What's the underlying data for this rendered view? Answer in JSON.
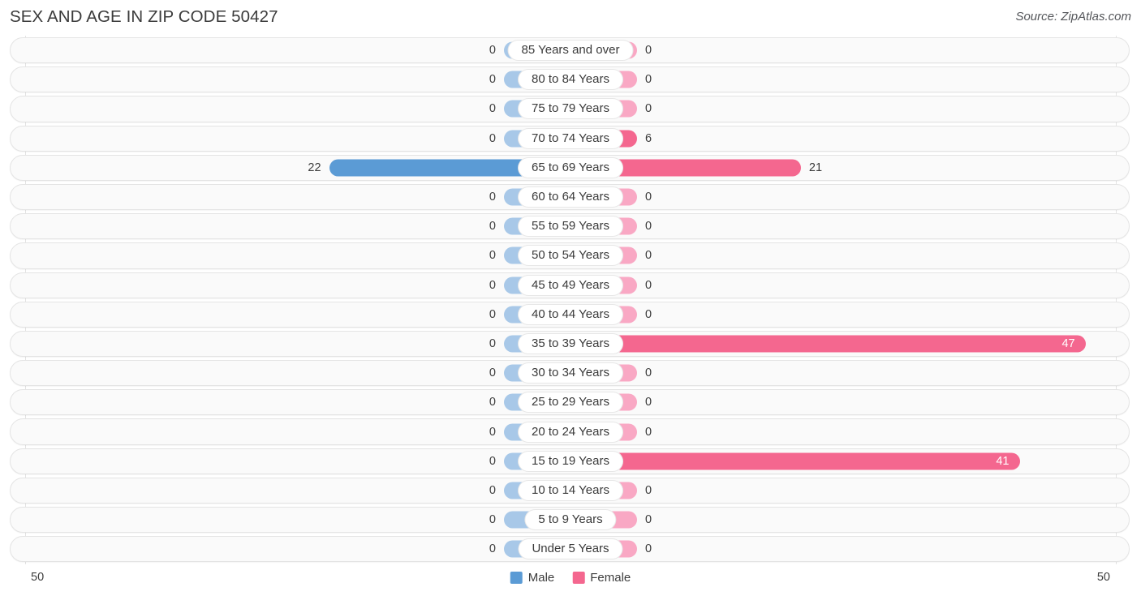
{
  "header": {
    "title": "SEX AND AGE IN ZIP CODE 50427",
    "source": "Source: ZipAtlas.com"
  },
  "footer": {
    "axis_left": "50",
    "axis_right": "50",
    "legend": [
      {
        "label": "Male",
        "color": "#5b9bd5",
        "swatch": "male"
      },
      {
        "label": "Female",
        "color": "#f4678f",
        "swatch": "female"
      }
    ]
  },
  "colors": {
    "male_light": "#a8c8e8",
    "male_strong": "#5b9bd5",
    "female_light": "#f9a8c4",
    "female_strong": "#f4678f",
    "track": "#fafafa",
    "track_border": "#e4e4e4",
    "gridline": "#e3e3e3"
  },
  "chart_data": {
    "type": "bar",
    "title": "SEX AND AGE IN ZIP CODE 50427",
    "subtitle": "",
    "xlabel": "",
    "ylabel": "",
    "orientation": "horizontal",
    "layout": "population-pyramid",
    "grid": true,
    "legend_position": "bottom-center",
    "axis_max": 50,
    "axis_min": 0,
    "xlim": [
      50,
      50
    ],
    "categories": [
      "85 Years and over",
      "80 to 84 Years",
      "75 to 79 Years",
      "70 to 74 Years",
      "65 to 69 Years",
      "60 to 64 Years",
      "55 to 59 Years",
      "50 to 54 Years",
      "45 to 49 Years",
      "40 to 44 Years",
      "35 to 39 Years",
      "30 to 34 Years",
      "25 to 29 Years",
      "20 to 24 Years",
      "15 to 19 Years",
      "10 to 14 Years",
      "5 to 9 Years",
      "Under 5 Years"
    ],
    "series": [
      {
        "name": "Male",
        "color": "#5b9bd5",
        "values": [
          0,
          0,
          0,
          0,
          22,
          0,
          0,
          0,
          0,
          0,
          0,
          0,
          0,
          0,
          0,
          0,
          0,
          0
        ]
      },
      {
        "name": "Female",
        "color": "#f4678f",
        "values": [
          0,
          0,
          0,
          6,
          21,
          0,
          0,
          0,
          0,
          0,
          47,
          0,
          0,
          0,
          41,
          0,
          0,
          0
        ]
      }
    ]
  },
  "rows": [
    {
      "label": "85 Years and over",
      "male": "0",
      "female": "0"
    },
    {
      "label": "80 to 84 Years",
      "male": "0",
      "female": "0"
    },
    {
      "label": "75 to 79 Years",
      "male": "0",
      "female": "0"
    },
    {
      "label": "70 to 74 Years",
      "male": "0",
      "female": "6"
    },
    {
      "label": "65 to 69 Years",
      "male": "22",
      "female": "21"
    },
    {
      "label": "60 to 64 Years",
      "male": "0",
      "female": "0"
    },
    {
      "label": "55 to 59 Years",
      "male": "0",
      "female": "0"
    },
    {
      "label": "50 to 54 Years",
      "male": "0",
      "female": "0"
    },
    {
      "label": "45 to 49 Years",
      "male": "0",
      "female": "0"
    },
    {
      "label": "40 to 44 Years",
      "male": "0",
      "female": "0"
    },
    {
      "label": "35 to 39 Years",
      "male": "0",
      "female": "47"
    },
    {
      "label": "30 to 34 Years",
      "male": "0",
      "female": "0"
    },
    {
      "label": "25 to 29 Years",
      "male": "0",
      "female": "0"
    },
    {
      "label": "20 to 24 Years",
      "male": "0",
      "female": "0"
    },
    {
      "label": "15 to 19 Years",
      "male": "0",
      "female": "41"
    },
    {
      "label": "10 to 14 Years",
      "male": "0",
      "female": "0"
    },
    {
      "label": "5 to 9 Years",
      "male": "0",
      "female": "0"
    },
    {
      "label": "Under 5 Years",
      "male": "0",
      "female": "0"
    }
  ]
}
